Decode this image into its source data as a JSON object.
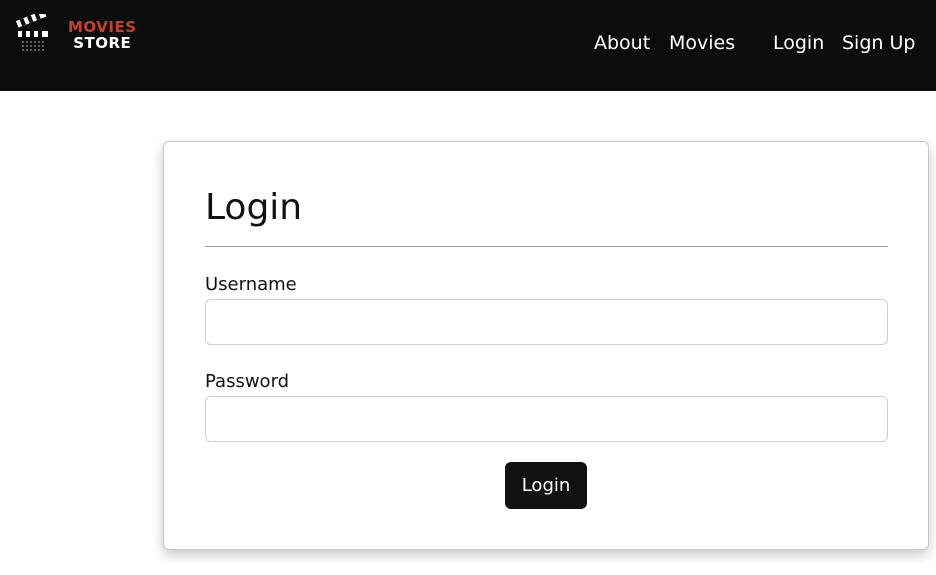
{
  "brand": {
    "name_line1": "MOVIES",
    "name_line2": "STORE",
    "icon": "clapperboard-icon"
  },
  "nav": {
    "items": [
      {
        "label": "About"
      },
      {
        "label": "Movies"
      },
      {
        "label": "Login"
      },
      {
        "label": "Sign Up"
      }
    ]
  },
  "login_form": {
    "title": "Login",
    "username": {
      "label": "Username",
      "value": "",
      "placeholder": ""
    },
    "password": {
      "label": "Password",
      "value": "",
      "placeholder": ""
    },
    "submit_label": "Login"
  },
  "colors": {
    "navbar_bg": "#0c0c0c",
    "brand_accent": "#c9402a",
    "button_bg": "#111111"
  }
}
